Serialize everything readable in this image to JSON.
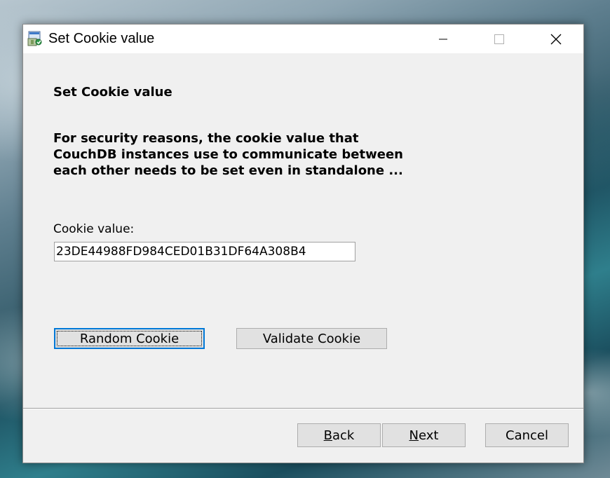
{
  "window": {
    "title": "Set Cookie value",
    "icon": "installer-icon",
    "controls": {
      "minimize": "minimize-icon",
      "maximize": "maximize-icon",
      "close": "close-icon"
    }
  },
  "page": {
    "heading": "Set Cookie value",
    "description": "For security reasons, the cookie value that CouchDB instances use to communicate between each other needs to be set even in standalone ...",
    "description_lines": [
      "For security reasons, the cookie value that",
      "CouchDB instances use to communicate between",
      "each other needs to be set even in standalone ..."
    ]
  },
  "cookie_field": {
    "label": "Cookie value:",
    "value": "23DE44988FD984CED01B31DF64A308B4"
  },
  "actions": {
    "random_label": "Random Cookie",
    "validate_label": "Validate Cookie"
  },
  "footer": {
    "back_label": "Back",
    "back_accel": "B",
    "back_rest": "ack",
    "next_label": "Next",
    "next_accel": "N",
    "next_rest": "ext",
    "cancel_label": "Cancel"
  },
  "colors": {
    "window_bg": "#f0f0f0",
    "titlebar_bg": "#ffffff",
    "focus_accent": "#0078d7",
    "button_bg": "#e1e1e1"
  }
}
